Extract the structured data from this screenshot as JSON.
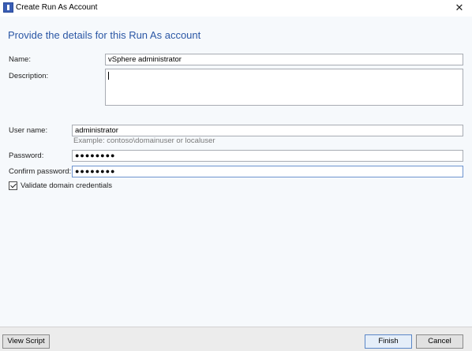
{
  "window": {
    "title": "Create Run As Account",
    "close_glyph": "✕"
  },
  "heading": "Provide the details for this Run As account",
  "form": {
    "name_label": "Name:",
    "name_value": "vSphere administrator",
    "description_label": "Description:",
    "description_value": "",
    "username_label": "User name:",
    "username_value": "administrator",
    "username_hint": "Example: contoso\\domainuser or localuser",
    "password_label": "Password:",
    "password_value": "●●●●●●●●",
    "confirm_label": "Confirm password:",
    "confirm_value": "●●●●●●●●",
    "validate_label": "Validate domain credentials",
    "validate_checked": true
  },
  "footer": {
    "view_script_label": "View Script",
    "finish_label": "Finish",
    "cancel_label": "Cancel"
  }
}
